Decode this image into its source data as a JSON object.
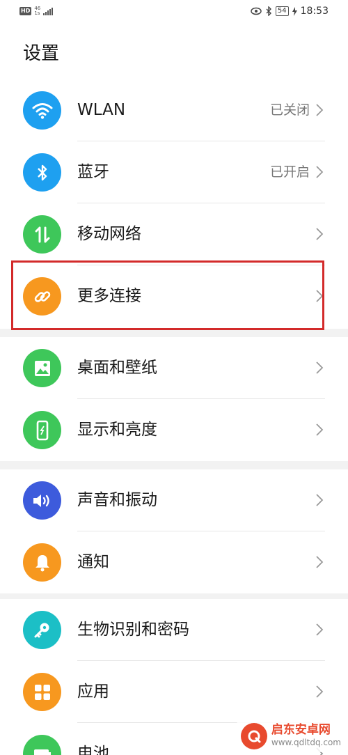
{
  "status_bar": {
    "hd": "HD",
    "net_top": "46",
    "net_bottom": "1s",
    "battery": "54",
    "time": "18:53"
  },
  "page": {
    "title": "设置"
  },
  "groups": [
    {
      "items": [
        {
          "label": "WLAN",
          "value": "已关闭",
          "icon": "wifi-icon",
          "color": "#1ea0f0"
        },
        {
          "label": "蓝牙",
          "value": "已开启",
          "icon": "bluetooth-icon",
          "color": "#1ea0f0"
        },
        {
          "label": "移动网络",
          "value": "",
          "icon": "mobile-data-icon",
          "color": "#3ec75a"
        },
        {
          "label": "更多连接",
          "value": "",
          "icon": "link-icon",
          "color": "#f7981f"
        }
      ]
    },
    {
      "items": [
        {
          "label": "桌面和壁纸",
          "value": "",
          "icon": "image-icon",
          "color": "#3ec75a"
        },
        {
          "label": "显示和亮度",
          "value": "",
          "icon": "display-icon",
          "color": "#3ec75a"
        }
      ]
    },
    {
      "items": [
        {
          "label": "声音和振动",
          "value": "",
          "icon": "volume-icon",
          "color": "#3d5bdc"
        },
        {
          "label": "通知",
          "value": "",
          "icon": "bell-icon",
          "color": "#f7981f"
        }
      ]
    },
    {
      "items": [
        {
          "label": "生物识别和密码",
          "value": "",
          "icon": "key-icon",
          "color": "#1cbfc6"
        },
        {
          "label": "应用",
          "value": "",
          "icon": "apps-grid-icon",
          "color": "#f7981f"
        },
        {
          "label": "电池",
          "value": "",
          "icon": "battery-icon",
          "color": "#3ec75a"
        }
      ]
    }
  ],
  "watermark": {
    "title": "启东安卓网",
    "url": "www.qdltdq.com"
  }
}
